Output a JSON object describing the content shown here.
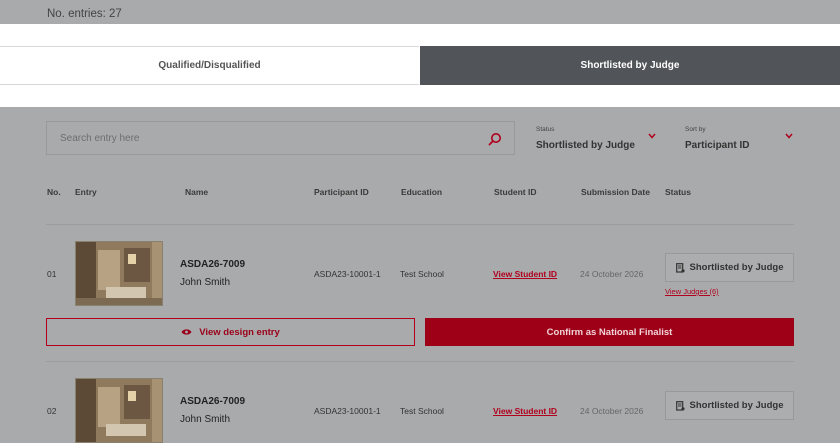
{
  "summary": {
    "entries_label": "No. entries: 27"
  },
  "tabs": [
    {
      "label": "Qualified/Disqualified",
      "active": false
    },
    {
      "label": "Shortlisted by Judge",
      "active": true
    }
  ],
  "search": {
    "placeholder": "Search entry here",
    "value": ""
  },
  "filters": {
    "status": {
      "label": "Status",
      "value": "Shortlisted by Judge"
    },
    "sort": {
      "label": "Sort by",
      "value": "Participant ID"
    }
  },
  "table": {
    "headers": {
      "no": "No.",
      "entry": "Entry",
      "name": "Name",
      "participant_id": "Participant ID",
      "education": "Education",
      "student_id": "Student ID",
      "submission_date": "Submission Date",
      "status": "Status"
    },
    "rows": [
      {
        "no": "01",
        "entry_code": "ASDA26-7009",
        "name": "John Smith",
        "participant_id": "ASDA23-10001-1",
        "education": "Test School",
        "student_id_link": "View Student ID",
        "submission_date": "24 October 2026",
        "status": "Shortlisted by Judge",
        "view_judges": "View Judges (6)",
        "view_entry_label": "View design entry",
        "confirm_label": "Confirm as National Finalist"
      },
      {
        "no": "02",
        "entry_code": "ASDA26-7009",
        "name": "John Smith",
        "participant_id": "ASDA23-10001-1",
        "education": "Test School",
        "student_id_link": "View Student ID",
        "submission_date": "24 October 2026",
        "status": "Shortlisted by Judge"
      }
    ]
  },
  "colors": {
    "accent": "#b0001e",
    "active_tab": "#515559",
    "overlay": "#a9aaab"
  },
  "icons": {
    "search": "search-icon",
    "dropdown": "chevron-down-icon",
    "eye": "eye-icon",
    "badge": "document-badge-icon"
  }
}
